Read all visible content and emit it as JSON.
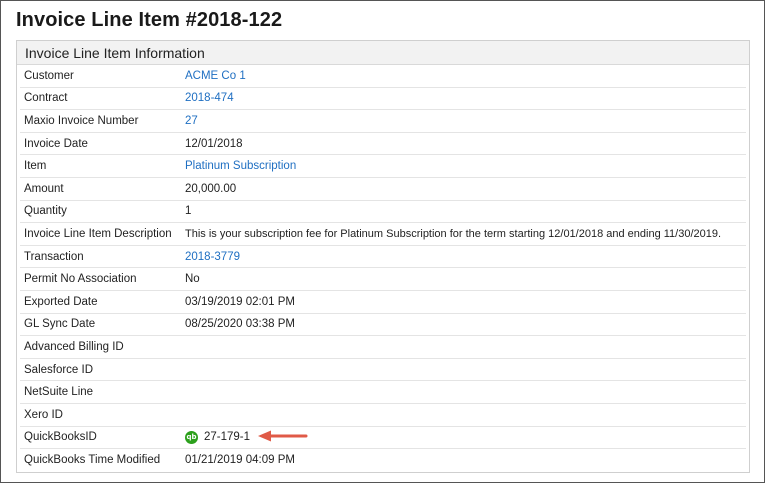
{
  "page": {
    "title": "Invoice Line Item #2018-122"
  },
  "panel": {
    "header": "Invoice Line Item Information"
  },
  "fields": [
    {
      "label": "Customer",
      "value": "ACME Co 1",
      "link": true
    },
    {
      "label": "Contract",
      "value": "2018-474",
      "link": true
    },
    {
      "label": "Maxio Invoice Number",
      "value": "27",
      "link": true
    },
    {
      "label": "Invoice Date",
      "value": "12/01/2018",
      "link": false
    },
    {
      "label": "Item",
      "value": "Platinum Subscription",
      "link": true
    },
    {
      "label": "Amount",
      "value": "20,000.00",
      "link": false
    },
    {
      "label": "Quantity",
      "value": "1",
      "link": false
    },
    {
      "label": "Invoice Line Item Description",
      "value": "This is your subscription fee for Platinum Subscription for the term starting 12/01/2018 and ending 11/30/2019.",
      "link": false
    },
    {
      "label": "Transaction",
      "value": "2018-3779",
      "link": true
    },
    {
      "label": "Permit No Association",
      "value": "No",
      "link": false
    },
    {
      "label": "Exported Date",
      "value": "03/19/2019 02:01 PM",
      "link": false
    },
    {
      "label": "GL Sync Date",
      "value": "08/25/2020 03:38 PM",
      "link": false
    },
    {
      "label": "Advanced Billing ID",
      "value": "",
      "link": false
    },
    {
      "label": "Salesforce ID",
      "value": "",
      "link": false
    },
    {
      "label": "NetSuite Line",
      "value": "",
      "link": false
    },
    {
      "label": "Xero ID",
      "value": "",
      "link": false
    },
    {
      "label": "QuickBooksID",
      "value": "27-179-1",
      "link": false,
      "icon": "quickbooks-icon",
      "icon_text": "qb",
      "annotation": "red-arrow-icon"
    },
    {
      "label": "QuickBooks Time Modified",
      "value": "01/21/2019 04:09 PM",
      "link": false
    }
  ],
  "colors": {
    "link": "#1f6fc2",
    "quickbooks": "#2ca01c",
    "annotation_arrow": "#e05a47"
  }
}
